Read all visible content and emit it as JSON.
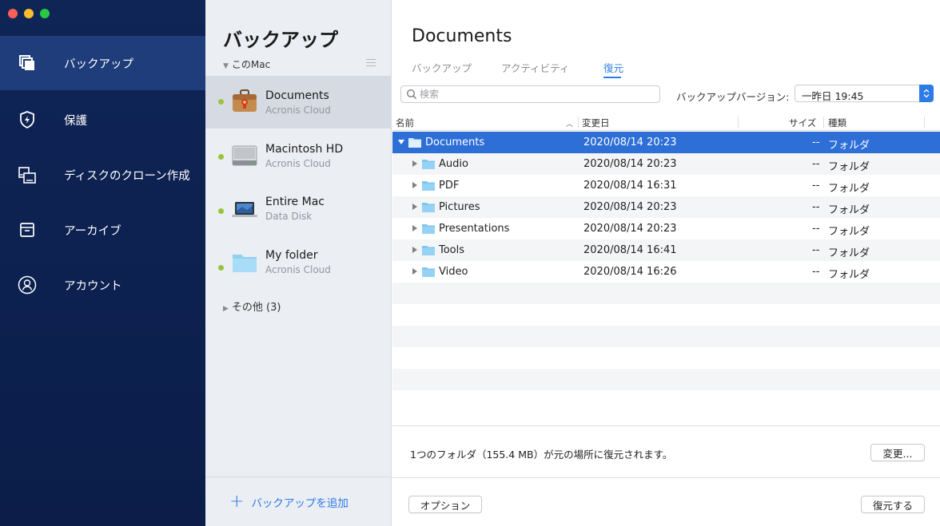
{
  "sidebar": {
    "items": [
      {
        "label": "バックアップ",
        "icon": "backup-icon",
        "active": true
      },
      {
        "label": "保護",
        "icon": "shield-icon",
        "active": false
      },
      {
        "label": "ディスクのクローン作成",
        "icon": "disk-clone-icon",
        "active": false
      },
      {
        "label": "アーカイブ",
        "icon": "archive-icon",
        "active": false
      },
      {
        "label": "アカウント",
        "icon": "account-icon",
        "active": false
      }
    ]
  },
  "backups": {
    "title": "バックアップ",
    "group_label": "このMac",
    "items": [
      {
        "name": "Documents",
        "location": "Acronis Cloud",
        "icon": "briefcase-icon",
        "selected": true
      },
      {
        "name": "Macintosh HD",
        "location": "Acronis Cloud",
        "icon": "hard-drive-icon",
        "selected": false
      },
      {
        "name": "Entire Mac",
        "location": "Data Disk",
        "icon": "laptop-icon",
        "selected": false
      },
      {
        "name": "My folder",
        "location": "Acronis Cloud",
        "icon": "folder-icon",
        "selected": false
      }
    ],
    "others_label": "その他 (3)",
    "add_label": "バックアップを追加"
  },
  "main": {
    "title": "Documents",
    "tabs": [
      {
        "label": "バックアップ",
        "active": false
      },
      {
        "label": "アクティビティ",
        "active": false
      },
      {
        "label": "復元",
        "active": true
      }
    ],
    "search_placeholder": "検索",
    "version_label": "バックアップバージョン:",
    "version_value": "一昨日 19:45",
    "columns": {
      "name": "名前",
      "modified": "変更日",
      "size": "サイズ",
      "kind": "種類"
    },
    "rows": [
      {
        "name": "Documents",
        "modified": "2020/08/14 20:23",
        "size": "--",
        "kind": "フォルダ",
        "level": 0,
        "expanded": true,
        "selected": true
      },
      {
        "name": "Audio",
        "modified": "2020/08/14 20:23",
        "size": "--",
        "kind": "フォルダ",
        "level": 1,
        "expanded": false,
        "selected": false
      },
      {
        "name": "PDF",
        "modified": "2020/08/14 16:31",
        "size": "--",
        "kind": "フォルダ",
        "level": 1,
        "expanded": false,
        "selected": false
      },
      {
        "name": "Pictures",
        "modified": "2020/08/14 20:23",
        "size": "--",
        "kind": "フォルダ",
        "level": 1,
        "expanded": false,
        "selected": false
      },
      {
        "name": "Presentations",
        "modified": "2020/08/14 20:23",
        "size": "--",
        "kind": "フォルダ",
        "level": 1,
        "expanded": false,
        "selected": false
      },
      {
        "name": "Tools",
        "modified": "2020/08/14 16:41",
        "size": "--",
        "kind": "フォルダ",
        "level": 1,
        "expanded": false,
        "selected": false
      },
      {
        "name": "Video",
        "modified": "2020/08/14 16:26",
        "size": "--",
        "kind": "フォルダ",
        "level": 1,
        "expanded": false,
        "selected": false
      }
    ],
    "summary": "1つのフォルダ（155.4 MB）が元の場所に復元されます。",
    "change_label": "変更...",
    "options_label": "オプション",
    "restore_label": "復元する"
  },
  "colors": {
    "accent": "#2d7be6",
    "sidebar_bg": "#0f2556",
    "status_dot": "#9ac33c"
  }
}
